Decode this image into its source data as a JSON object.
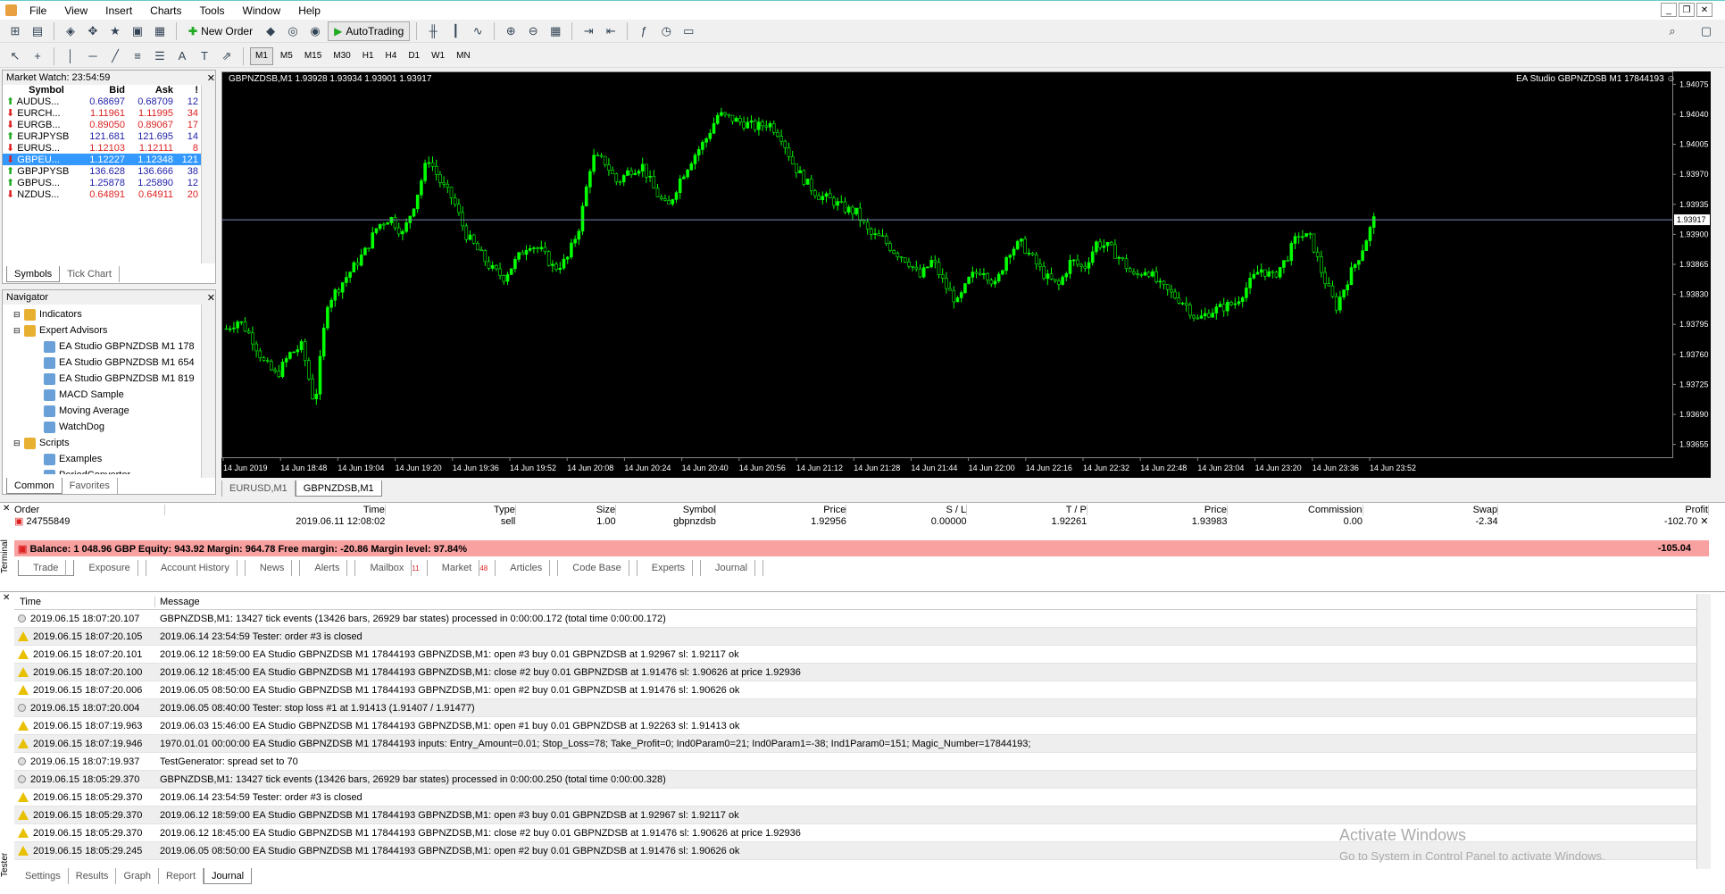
{
  "menu": [
    "File",
    "View",
    "Insert",
    "Charts",
    "Tools",
    "Window",
    "Help"
  ],
  "toolbar": {
    "new_order": "New Order",
    "autotrading": "AutoTrading",
    "timeframes": [
      "M1",
      "M5",
      "M15",
      "M30",
      "H1",
      "H4",
      "D1",
      "W1",
      "MN"
    ]
  },
  "market_watch": {
    "title": "Market Watch: 23:54:59",
    "headers": [
      "Symbol",
      "Bid",
      "Ask",
      "!"
    ],
    "rows": [
      {
        "symbol": "AUDUS...",
        "bid": "0.68697",
        "ask": "0.68709",
        "spread": "12",
        "dir": "up"
      },
      {
        "symbol": "EURCH...",
        "bid": "1.11961",
        "ask": "1.11995",
        "spread": "34",
        "dir": "down"
      },
      {
        "symbol": "EURGB...",
        "bid": "0.89050",
        "ask": "0.89067",
        "spread": "17",
        "dir": "down"
      },
      {
        "symbol": "EURJPYSB",
        "bid": "121.681",
        "ask": "121.695",
        "spread": "14",
        "dir": "up"
      },
      {
        "symbol": "EURUS...",
        "bid": "1.12103",
        "ask": "1.12111",
        "spread": "8",
        "dir": "down"
      },
      {
        "symbol": "GBPEU...",
        "bid": "1.12227",
        "ask": "1.12348",
        "spread": "121",
        "dir": "down",
        "selected": true
      },
      {
        "symbol": "GBPJPYSB",
        "bid": "136.628",
        "ask": "136.666",
        "spread": "38",
        "dir": "up"
      },
      {
        "symbol": "GBPUS...",
        "bid": "1.25878",
        "ask": "1.25890",
        "spread": "12",
        "dir": "up"
      },
      {
        "symbol": "NZDUS...",
        "bid": "0.64891",
        "ask": "0.64911",
        "spread": "20",
        "dir": "down"
      }
    ],
    "tabs": [
      "Symbols",
      "Tick Chart"
    ]
  },
  "navigator": {
    "title": "Navigator",
    "items": [
      {
        "label": "Indicators",
        "level": 1
      },
      {
        "label": "Expert Advisors",
        "level": 1
      },
      {
        "label": "EA Studio GBPNZDSB M1 178",
        "level": 2
      },
      {
        "label": "EA Studio GBPNZDSB M1 654",
        "level": 2
      },
      {
        "label": "EA Studio GBPNZDSB M1 819",
        "level": 2
      },
      {
        "label": "MACD Sample",
        "level": 2
      },
      {
        "label": "Moving Average",
        "level": 2
      },
      {
        "label": "WatchDog",
        "level": 2
      },
      {
        "label": "Scripts",
        "level": 1
      },
      {
        "label": "Examples",
        "level": 2
      },
      {
        "label": "PeriodConverter",
        "level": 2
      }
    ],
    "tabs": [
      "Common",
      "Favorites"
    ]
  },
  "chart": {
    "header": "GBPNZDSB,M1  1.93928 1.93934 1.93901 1.93917",
    "ea_label": "EA Studio GBPNZDSB M1 17844193 ☺",
    "current_price": "1.93917",
    "y_labels": [
      "1.94075",
      "1.94040",
      "1.94005",
      "1.93970",
      "1.93935",
      "1.93900",
      "1.93865",
      "1.93830",
      "1.93795",
      "1.93760",
      "1.93725",
      "1.93690",
      "1.93655"
    ],
    "x_labels": [
      "14 Jun 2019",
      "14 Jun 18:48",
      "14 Jun 19:04",
      "14 Jun 19:20",
      "14 Jun 19:36",
      "14 Jun 19:52",
      "14 Jun 20:08",
      "14 Jun 20:24",
      "14 Jun 20:40",
      "14 Jun 20:56",
      "14 Jun 21:12",
      "14 Jun 21:28",
      "14 Jun 21:44",
      "14 Jun 22:00",
      "14 Jun 22:16",
      "14 Jun 22:32",
      "14 Jun 22:48",
      "14 Jun 23:04",
      "14 Jun 23:20",
      "14 Jun 23:36",
      "14 Jun 23:52"
    ],
    "tabs": [
      "EURUSD,M1",
      "GBPNZDSB,M1"
    ],
    "ymin": 1.9364,
    "ymax": 1.9409,
    "closes": [
      1.9379,
      1.938,
      1.9378,
      1.9375,
      1.93735,
      1.9376,
      1.9377,
      1.937,
      1.9382,
      1.9384,
      1.9386,
      1.9388,
      1.9391,
      1.9392,
      1.939,
      1.9394,
      1.9399,
      1.9396,
      1.9394,
      1.939,
      1.9388,
      1.9386,
      1.9385,
      1.9387,
      1.9389,
      1.9388,
      1.9386,
      1.9387,
      1.9391,
      1.9399,
      1.93985,
      1.9396,
      1.93975,
      1.9398,
      1.9395,
      1.9393,
      1.93965,
      1.9399,
      1.9401,
      1.9404,
      1.94035,
      1.9403,
      1.94025,
      1.9403,
      1.94015,
      1.9398,
      1.9396,
      1.93945,
      1.9394,
      1.9393,
      1.93925,
      1.939,
      1.93895,
      1.9388,
      1.9387,
      1.9385,
      1.9387,
      1.9384,
      1.9382,
      1.9385,
      1.9386,
      1.9384,
      1.9388,
      1.9389,
      1.9387,
      1.9385,
      1.9384,
      1.9387,
      1.9386,
      1.9389,
      1.93885,
      1.9387,
      1.9385,
      1.9386,
      1.9384,
      1.9383,
      1.9382,
      1.938,
      1.9381,
      1.93815,
      1.9382,
      1.9384,
      1.9386,
      1.9385,
      1.9387,
      1.939,
      1.93895,
      1.9385,
      1.93815,
      1.9385,
      1.9388,
      1.93917
    ]
  },
  "terminal": {
    "headers": [
      "Order",
      "Time",
      "Type",
      "Size",
      "Symbol",
      "Price",
      "S / L",
      "T / P",
      "Price",
      "Commission",
      "Swap",
      "Profit"
    ],
    "order": {
      "id": "24755849",
      "time": "2019.06.11 12:08:02",
      "type": "sell",
      "size": "1.00",
      "symbol": "gbpnzdsb",
      "price": "1.92956",
      "sl": "0.00000",
      "tp": "1.92261",
      "cur": "1.93983",
      "commission": "0.00",
      "swap": "-2.34",
      "profit": "-102.70"
    },
    "balance": "Balance: 1 048.96 GBP  Equity: 943.92  Margin: 964.78  Free margin: -20.86  Margin level: 97.84%",
    "balance_profit": "-105.04",
    "tabs": [
      "Trade",
      "Exposure",
      "Account History",
      "News",
      "Alerts",
      "Mailbox",
      "Market",
      "Articles",
      "Code Base",
      "Experts",
      "Journal"
    ],
    "mailbox_badge": "11",
    "market_badge": "48",
    "side_label": "Terminal"
  },
  "tester": {
    "headers": [
      "Time",
      "Message"
    ],
    "rows": [
      {
        "icon": "info",
        "time": "2019.06.15 18:07:20.107",
        "msg": "GBPNZDSB,M1: 13427 tick events (13426 bars, 26929 bar states) processed in 0:00:00.172 (total time 0:00:00.172)"
      },
      {
        "icon": "warn",
        "time": "2019.06.15 18:07:20.105",
        "msg": "2019.06.14 23:54:59  Tester: order #3 is closed"
      },
      {
        "icon": "warn",
        "time": "2019.06.15 18:07:20.101",
        "msg": "2019.06.12 18:59:00  EA Studio GBPNZDSB M1 17844193 GBPNZDSB,M1: open #3 buy 0.01 GBPNZDSB at 1.92967 sl: 1.92117 ok"
      },
      {
        "icon": "warn",
        "time": "2019.06.15 18:07:20.100",
        "msg": "2019.06.12 18:45:00  EA Studio GBPNZDSB M1 17844193 GBPNZDSB,M1: close #2 buy 0.01 GBPNZDSB at 1.91476 sl: 1.90626 at price 1.92936"
      },
      {
        "icon": "warn",
        "time": "2019.06.15 18:07:20.006",
        "msg": "2019.06.05 08:50:00  EA Studio GBPNZDSB M1 17844193 GBPNZDSB,M1: open #2 buy 0.01 GBPNZDSB at 1.91476 sl: 1.90626 ok"
      },
      {
        "icon": "info",
        "time": "2019.06.15 18:07:20.004",
        "msg": "2019.06.05 08:40:00  Tester: stop loss #1 at 1.91413 (1.91407 / 1.91477)"
      },
      {
        "icon": "warn",
        "time": "2019.06.15 18:07:19.963",
        "msg": "2019.06.03 15:46:00  EA Studio GBPNZDSB M1 17844193 GBPNZDSB,M1: open #1 buy 0.01 GBPNZDSB at 1.92263 sl: 1.91413 ok"
      },
      {
        "icon": "warn",
        "time": "2019.06.15 18:07:19.946",
        "msg": "1970.01.01 00:00:00  EA Studio GBPNZDSB M1 17844193 inputs: Entry_Amount=0.01; Stop_Loss=78; Take_Profit=0; Ind0Param0=21; Ind0Param1=-38; Ind1Param0=151; Magic_Number=17844193;"
      },
      {
        "icon": "info",
        "time": "2019.06.15 18:07:19.937",
        "msg": "TestGenerator: spread set to 70"
      },
      {
        "icon": "info",
        "time": "2019.06.15 18:05:29.370",
        "msg": "GBPNZDSB,M1: 13427 tick events (13426 bars, 26929 bar states) processed in 0:00:00.250 (total time 0:00:00.328)"
      },
      {
        "icon": "warn",
        "time": "2019.06.15 18:05:29.370",
        "msg": "2019.06.14 23:54:59  Tester: order #3 is closed"
      },
      {
        "icon": "warn",
        "time": "2019.06.15 18:05:29.370",
        "msg": "2019.06.12 18:59:00  EA Studio GBPNZDSB M1 17844193 GBPNZDSB,M1: open #3 buy 0.01 GBPNZDSB at 1.92967 sl: 1.92117 ok"
      },
      {
        "icon": "warn",
        "time": "2019.06.15 18:05:29.370",
        "msg": "2019.06.12 18:45:00  EA Studio GBPNZDSB M1 17844193 GBPNZDSB,M1: close #2 buy 0.01 GBPNZDSB at 1.91476 sl: 1.90626 at price 1.92936"
      },
      {
        "icon": "warn",
        "time": "2019.06.15 18:05:29.245",
        "msg": "2019.06.05 08:50:00  EA Studio GBPNZDSB M1 17844193 GBPNZDSB,M1: open #2 buy 0.01 GBPNZDSB at 1.91476 sl: 1.90626 ok"
      }
    ],
    "tabs": [
      "Settings",
      "Results",
      "Graph",
      "Report",
      "Journal"
    ],
    "side_label": "Tester"
  },
  "watermark": {
    "line1": "Activate Windows",
    "line2": "Go to System in Control Panel to activate Windows."
  }
}
